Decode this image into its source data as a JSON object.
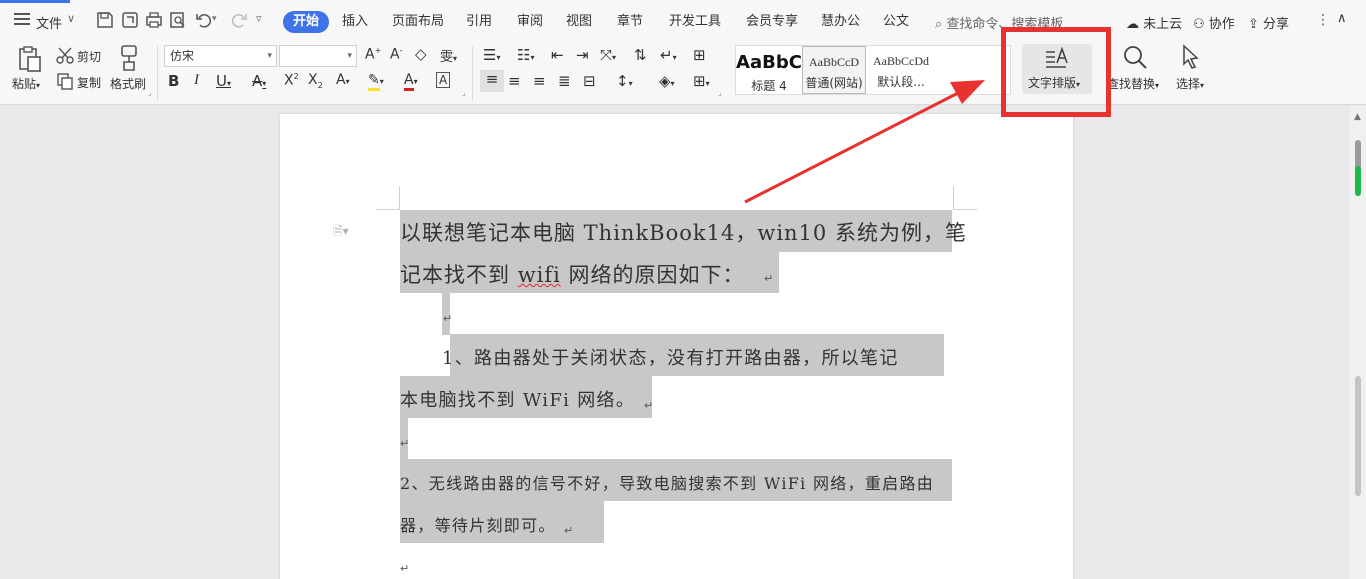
{
  "menu": {
    "file_label": "文件"
  },
  "tabs": [
    {
      "label": "开始"
    },
    {
      "label": "插入"
    },
    {
      "label": "页面布局"
    },
    {
      "label": "引用"
    },
    {
      "label": "审阅"
    },
    {
      "label": "视图"
    },
    {
      "label": "章节"
    },
    {
      "label": "开发工具"
    },
    {
      "label": "会员专享"
    },
    {
      "label": "慧办公"
    },
    {
      "label": "公文"
    }
  ],
  "search": {
    "label": "查找命令、搜索模板"
  },
  "right_actions": {
    "cloud": "未上云",
    "collab": "协作",
    "share": "分享"
  },
  "ribbon": {
    "paste": "粘贴",
    "cut": "剪切",
    "copy": "复制",
    "format_painter": "格式刷",
    "font_name": "仿宋",
    "font_size": "",
    "styles": [
      {
        "sample": "AaBbC",
        "name": "标题 4"
      },
      {
        "sample": "AaBbCcD",
        "name": "普通(网站)"
      },
      {
        "sample": "AaBbCcDd",
        "name": "默认段..."
      }
    ],
    "text_layout": "文字排版",
    "find_replace": "查找替换",
    "select": "选择"
  },
  "document": {
    "p1_line1": "以联想笔记本电脑 ThinkBook14，win10 系统为例，笔",
    "p1_line2a": "记本找不到 ",
    "p1_line2_wifi": "wifi",
    "p1_line2b": " 网络的原因如下：",
    "p2_line1": "1、路由器处于关闭状态，没有打开路由器，所以笔记",
    "p2_line2": "本电脑找不到 WiFi 网络。",
    "p3_line1": "2、无线路由器的信号不好，导致电脑搜索不到 WiFi 网络，重启路由",
    "p3_line2": "器，等待片刻即可。",
    "return_mark": "↵"
  },
  "colors": {
    "accent": "#3f73e8",
    "annotation": "#e8322f",
    "selection": "#c8c8c8"
  }
}
